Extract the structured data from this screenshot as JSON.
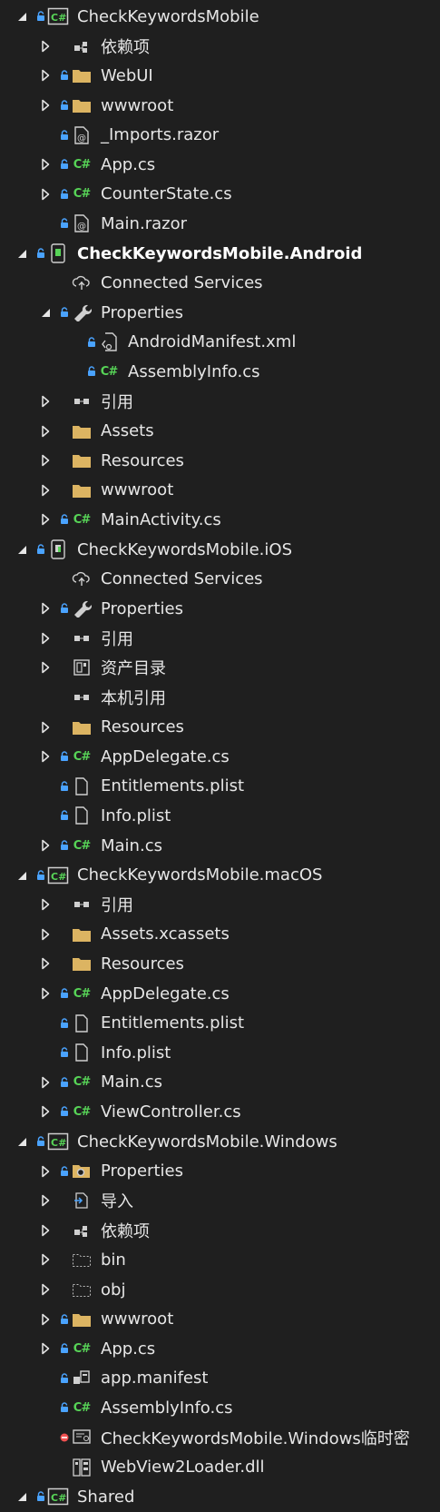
{
  "colors": {
    "background": "#1f1f1f",
    "text": "#e6e6e6",
    "folder": "#dcb462",
    "csharp": "#57d457",
    "lock": "#4aa3ff",
    "error": "#f05050"
  },
  "tree": {
    "items": [
      {
        "label": "CheckKeywordsMobile",
        "indent": 0,
        "expander": "open",
        "lock": true,
        "icon": "csharp-project-icon"
      },
      {
        "label": "依赖项",
        "indent": 1,
        "expander": "closed",
        "lock": false,
        "icon": "dependencies-icon"
      },
      {
        "label": "WebUI",
        "indent": 1,
        "expander": "closed",
        "lock": true,
        "icon": "folder-icon"
      },
      {
        "label": "wwwroot",
        "indent": 1,
        "expander": "closed",
        "lock": true,
        "icon": "folder-icon"
      },
      {
        "label": "_Imports.razor",
        "indent": 1,
        "expander": "none",
        "lock": true,
        "icon": "razor-file-icon"
      },
      {
        "label": "App.cs",
        "indent": 1,
        "expander": "closed",
        "lock": true,
        "icon": "csharp-file-icon"
      },
      {
        "label": "CounterState.cs",
        "indent": 1,
        "expander": "closed",
        "lock": true,
        "icon": "csharp-file-icon"
      },
      {
        "label": "Main.razor",
        "indent": 1,
        "expander": "none",
        "lock": true,
        "icon": "razor-file-icon"
      },
      {
        "label": "CheckKeywordsMobile.Android",
        "indent": 0,
        "expander": "open",
        "lock": true,
        "icon": "android-project-icon",
        "bold": true
      },
      {
        "label": "Connected Services",
        "indent": 1,
        "expander": "none",
        "lock": false,
        "icon": "connected-services-icon"
      },
      {
        "label": "Properties",
        "indent": 1,
        "expander": "open",
        "lock": true,
        "icon": "wrench-icon"
      },
      {
        "label": "AndroidManifest.xml",
        "indent": 2,
        "expander": "none",
        "lock": true,
        "icon": "xml-file-icon"
      },
      {
        "label": "AssemblyInfo.cs",
        "indent": 2,
        "expander": "none",
        "lock": true,
        "icon": "csharp-file-icon"
      },
      {
        "label": "引用",
        "indent": 1,
        "expander": "closed",
        "lock": false,
        "icon": "references-icon"
      },
      {
        "label": "Assets",
        "indent": 1,
        "expander": "closed",
        "lock": false,
        "icon": "folder-icon"
      },
      {
        "label": "Resources",
        "indent": 1,
        "expander": "closed",
        "lock": false,
        "icon": "folder-icon"
      },
      {
        "label": "wwwroot",
        "indent": 1,
        "expander": "closed",
        "lock": false,
        "icon": "folder-icon"
      },
      {
        "label": "MainActivity.cs",
        "indent": 1,
        "expander": "closed",
        "lock": true,
        "icon": "csharp-file-icon"
      },
      {
        "label": "CheckKeywordsMobile.iOS",
        "indent": 0,
        "expander": "open",
        "lock": true,
        "icon": "ios-project-icon"
      },
      {
        "label": "Connected Services",
        "indent": 1,
        "expander": "none",
        "lock": false,
        "icon": "connected-services-icon"
      },
      {
        "label": "Properties",
        "indent": 1,
        "expander": "closed",
        "lock": true,
        "icon": "wrench-icon"
      },
      {
        "label": "引用",
        "indent": 1,
        "expander": "closed",
        "lock": false,
        "icon": "references-icon"
      },
      {
        "label": "资产目录",
        "indent": 1,
        "expander": "closed",
        "lock": false,
        "icon": "asset-catalog-icon"
      },
      {
        "label": "本机引用",
        "indent": 1,
        "expander": "none",
        "lock": false,
        "icon": "references-icon"
      },
      {
        "label": "Resources",
        "indent": 1,
        "expander": "closed",
        "lock": false,
        "icon": "folder-icon"
      },
      {
        "label": "AppDelegate.cs",
        "indent": 1,
        "expander": "closed",
        "lock": true,
        "icon": "csharp-file-icon"
      },
      {
        "label": "Entitlements.plist",
        "indent": 1,
        "expander": "none",
        "lock": true,
        "icon": "file-icon"
      },
      {
        "label": "Info.plist",
        "indent": 1,
        "expander": "none",
        "lock": true,
        "icon": "file-icon"
      },
      {
        "label": "Main.cs",
        "indent": 1,
        "expander": "closed",
        "lock": true,
        "icon": "csharp-file-icon"
      },
      {
        "label": "CheckKeywordsMobile.macOS",
        "indent": 0,
        "expander": "open",
        "lock": true,
        "icon": "csharp-project-icon"
      },
      {
        "label": "引用",
        "indent": 1,
        "expander": "closed",
        "lock": false,
        "icon": "references-icon"
      },
      {
        "label": "Assets.xcassets",
        "indent": 1,
        "expander": "closed",
        "lock": false,
        "icon": "folder-icon"
      },
      {
        "label": "Resources",
        "indent": 1,
        "expander": "closed",
        "lock": false,
        "icon": "folder-icon"
      },
      {
        "label": "AppDelegate.cs",
        "indent": 1,
        "expander": "closed",
        "lock": true,
        "icon": "csharp-file-icon"
      },
      {
        "label": "Entitlements.plist",
        "indent": 1,
        "expander": "none",
        "lock": true,
        "icon": "file-icon"
      },
      {
        "label": "Info.plist",
        "indent": 1,
        "expander": "none",
        "lock": true,
        "icon": "file-icon"
      },
      {
        "label": "Main.cs",
        "indent": 1,
        "expander": "closed",
        "lock": true,
        "icon": "csharp-file-icon"
      },
      {
        "label": "ViewController.cs",
        "indent": 1,
        "expander": "closed",
        "lock": true,
        "icon": "csharp-file-icon"
      },
      {
        "label": "CheckKeywordsMobile.Windows",
        "indent": 0,
        "expander": "open",
        "lock": true,
        "icon": "csharp-project-icon"
      },
      {
        "label": "Properties",
        "indent": 1,
        "expander": "closed",
        "lock": true,
        "icon": "properties-icon"
      },
      {
        "label": "导入",
        "indent": 1,
        "expander": "closed",
        "lock": false,
        "icon": "imports-icon"
      },
      {
        "label": "依赖项",
        "indent": 1,
        "expander": "closed",
        "lock": false,
        "icon": "dependencies-icon"
      },
      {
        "label": "bin",
        "indent": 1,
        "expander": "closed",
        "lock": false,
        "icon": "hidden-folder-icon"
      },
      {
        "label": "obj",
        "indent": 1,
        "expander": "closed",
        "lock": false,
        "icon": "hidden-folder-icon"
      },
      {
        "label": "wwwroot",
        "indent": 1,
        "expander": "closed",
        "lock": true,
        "icon": "folder-icon"
      },
      {
        "label": "App.cs",
        "indent": 1,
        "expander": "closed",
        "lock": true,
        "icon": "csharp-file-icon"
      },
      {
        "label": "app.manifest",
        "indent": 1,
        "expander": "none",
        "lock": true,
        "icon": "manifest-icon"
      },
      {
        "label": "AssemblyInfo.cs",
        "indent": 1,
        "expander": "none",
        "lock": true,
        "icon": "csharp-file-icon"
      },
      {
        "label": "CheckKeywordsMobile.Windows临时密",
        "indent": 1,
        "expander": "none",
        "lock": "error",
        "icon": "certificate-icon"
      },
      {
        "label": "WebView2Loader.dll",
        "indent": 1,
        "expander": "none",
        "lock": false,
        "icon": "dll-icon"
      },
      {
        "label": "Shared",
        "indent": 0,
        "expander": "open",
        "lock": true,
        "icon": "csharp-project-icon"
      }
    ]
  }
}
